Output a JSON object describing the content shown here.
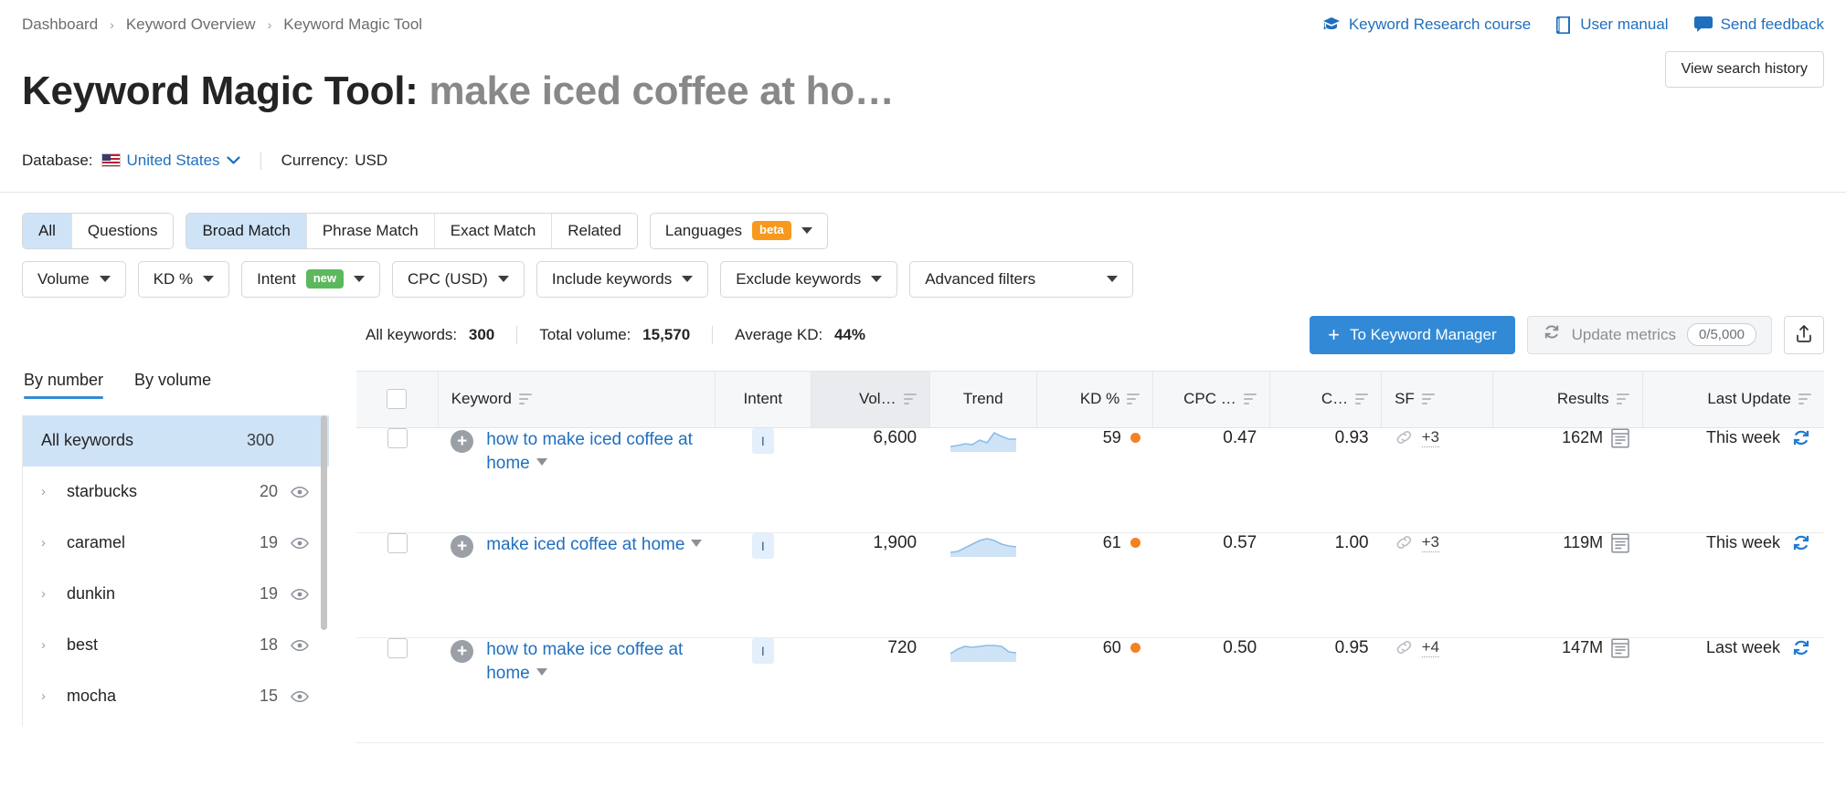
{
  "breadcrumb": {
    "items": [
      "Dashboard",
      "Keyword Overview",
      "Keyword Magic Tool"
    ],
    "separator": "›"
  },
  "top_links": [
    {
      "label": "Keyword Research course",
      "icon": "graduation-cap-icon"
    },
    {
      "label": "User manual",
      "icon": "book-icon"
    },
    {
      "label": "Send feedback",
      "icon": "speech-bubble-icon"
    }
  ],
  "header": {
    "tool_name": "Keyword Magic Tool:",
    "query": "make iced coffee at ho…",
    "history_button": "View search history"
  },
  "database": {
    "label": "Database:",
    "value": "United States",
    "flag": "us-flag-icon",
    "caret": "❯",
    "currency_label": "Currency:",
    "currency_value": "USD"
  },
  "filters": {
    "question_group": [
      {
        "label": "All",
        "active": true
      },
      {
        "label": "Questions",
        "active": false
      }
    ],
    "match_group": [
      {
        "label": "Broad Match",
        "active": true
      },
      {
        "label": "Phrase Match",
        "active": false
      },
      {
        "label": "Exact Match",
        "active": false
      },
      {
        "label": "Related",
        "active": false
      }
    ],
    "languages": {
      "label": "Languages",
      "badge": "beta"
    },
    "dropdowns": [
      {
        "label": "Volume",
        "badge": ""
      },
      {
        "label": "KD %",
        "badge": ""
      },
      {
        "label": "Intent",
        "badge": "new"
      },
      {
        "label": "CPC (USD)",
        "badge": ""
      },
      {
        "label": "Include keywords",
        "badge": ""
      },
      {
        "label": "Exclude keywords",
        "badge": ""
      },
      {
        "label": "Advanced filters",
        "badge": ""
      }
    ]
  },
  "stats": {
    "all_keywords_label": "All keywords:",
    "all_keywords_value": "300",
    "total_volume_label": "Total volume:",
    "total_volume_value": "15,570",
    "average_kd_label": "Average KD:",
    "average_kd_value": "44%"
  },
  "actions": {
    "to_keyword_manager": "To Keyword Manager",
    "plus": "+",
    "update_metrics": "Update metrics",
    "update_metrics_quota": "0/5,000",
    "export_icon": "export-icon"
  },
  "sidebar": {
    "tabs": [
      {
        "label": "By number",
        "active": true
      },
      {
        "label": "By volume",
        "active": false
      }
    ],
    "items": [
      {
        "label": "All keywords",
        "count": "300",
        "selected": true,
        "has_eye": false,
        "has_chevron": false
      },
      {
        "label": "starbucks",
        "count": "20",
        "selected": false,
        "has_eye": true,
        "has_chevron": true
      },
      {
        "label": "caramel",
        "count": "19",
        "selected": false,
        "has_eye": true,
        "has_chevron": true
      },
      {
        "label": "dunkin",
        "count": "19",
        "selected": false,
        "has_eye": true,
        "has_chevron": true
      },
      {
        "label": "best",
        "count": "18",
        "selected": false,
        "has_eye": true,
        "has_chevron": true
      },
      {
        "label": "mocha",
        "count": "15",
        "selected": false,
        "has_eye": true,
        "has_chevron": true
      }
    ]
  },
  "table": {
    "columns": [
      {
        "key": "checkbox",
        "label": "",
        "sortable": false,
        "align": "center",
        "sorted": false
      },
      {
        "key": "keyword",
        "label": "Keyword",
        "sortable": true,
        "align": "left",
        "sorted": false
      },
      {
        "key": "intent",
        "label": "Intent",
        "sortable": false,
        "align": "center",
        "sorted": false
      },
      {
        "key": "volume",
        "label": "Vol…",
        "sortable": true,
        "align": "right",
        "sorted": true
      },
      {
        "key": "trend",
        "label": "Trend",
        "sortable": false,
        "align": "center",
        "sorted": false
      },
      {
        "key": "kd",
        "label": "KD %",
        "sortable": true,
        "align": "right",
        "sorted": false
      },
      {
        "key": "cpc",
        "label": "CPC …",
        "sortable": true,
        "align": "right",
        "sorted": false
      },
      {
        "key": "com",
        "label": "C…",
        "sortable": true,
        "align": "right",
        "sorted": false
      },
      {
        "key": "sf",
        "label": "SF",
        "sortable": true,
        "align": "left",
        "sorted": false
      },
      {
        "key": "results",
        "label": "Results",
        "sortable": true,
        "align": "right",
        "sorted": false
      },
      {
        "key": "last_update",
        "label": "Last Update",
        "sortable": true,
        "align": "right",
        "sorted": false
      }
    ],
    "rows": [
      {
        "keyword": "how to make iced coffee at home",
        "intent": "I",
        "volume": "6,600",
        "kd": "59",
        "cpc": "0.47",
        "com": "0.93",
        "sf": "+3",
        "results": "162M",
        "last_update": "This week"
      },
      {
        "keyword": "make iced coffee at home",
        "intent": "I",
        "volume": "1,900",
        "kd": "61",
        "cpc": "0.57",
        "com": "1.00",
        "sf": "+3",
        "results": "119M",
        "last_update": "This week"
      },
      {
        "keyword": "how to make ice coffee at home",
        "intent": "I",
        "volume": "720",
        "kd": "60",
        "cpc": "0.50",
        "com": "0.95",
        "sf": "+4",
        "results": "147M",
        "last_update": "Last week"
      }
    ]
  },
  "colors": {
    "link": "#1f6fbf",
    "primary": "#328ad6",
    "kd_dot": "#f58220",
    "beta_badge": "#f8991d",
    "new_badge": "#5cb85c",
    "selected_row": "#cfe3f7"
  }
}
